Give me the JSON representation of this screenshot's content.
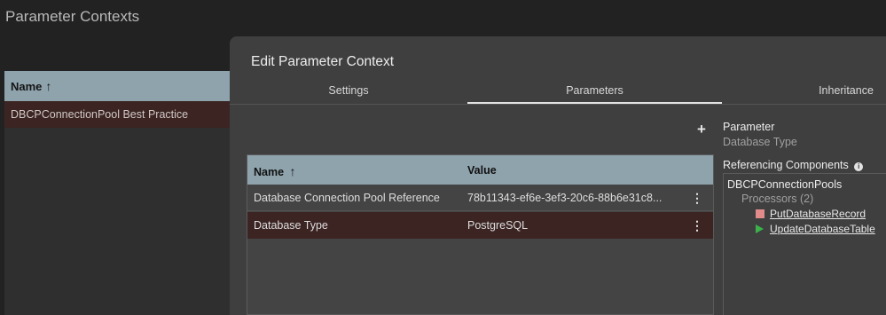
{
  "background": {
    "title": "Parameter Contexts",
    "table": {
      "column_name": "Name",
      "sort_icon": "arrow-up-icon",
      "rows": [
        "DBCPConnectionPool Best Practice"
      ]
    }
  },
  "dialog": {
    "title": "Edit Parameter Context",
    "tabs": [
      "Settings",
      "Parameters",
      "Inheritance"
    ],
    "active_tab": "Parameters",
    "add_icon": "plus-icon",
    "table": {
      "columns": [
        "Name",
        "Value"
      ],
      "sort_icon": "arrow-up-icon",
      "rows": [
        {
          "name": "Database Connection Pool Reference",
          "value": "78b11343-ef6e-3ef3-20c6-88b6e31c8...",
          "selected": false
        },
        {
          "name": "Database Type",
          "value": "PostgreSQL",
          "selected": true
        }
      ]
    },
    "side": {
      "parameter_label": "Parameter",
      "parameter_value": "Database Type",
      "referencing_label": "Referencing Components",
      "group": "DBCPConnectionPools",
      "processors_label": "Processors (2)",
      "processors": [
        {
          "name": "PutDatabaseRecord",
          "state": "stopped",
          "icon": "stop-icon",
          "color": "#e38b8b"
        },
        {
          "name": "UpdateDatabaseTable",
          "state": "running",
          "icon": "play-icon",
          "color": "#3bb24a"
        }
      ]
    }
  },
  "colors": {
    "header": "#8fa3ad",
    "selected_row": "#3b2422",
    "dialog_bg": "#3f3f3f",
    "page_bg": "#222222"
  }
}
